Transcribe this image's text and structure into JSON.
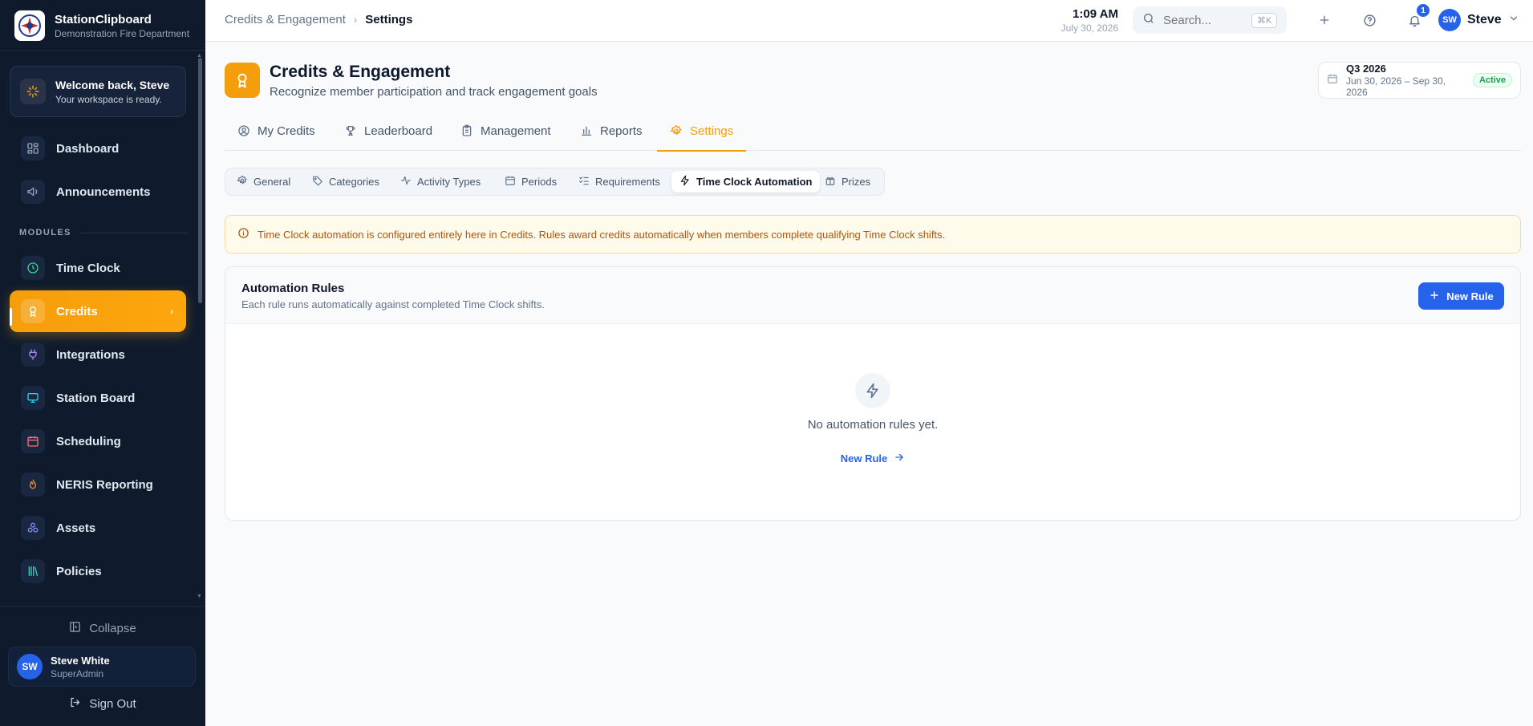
{
  "brand": {
    "name": "StationClipboard",
    "subtitle": "Demonstration Fire Department"
  },
  "welcome": {
    "title": "Welcome back, Steve",
    "subtitle": "Your workspace is ready."
  },
  "sidebar": {
    "section_label": "MODULES",
    "items": [
      {
        "label": "Dashboard",
        "icon": "grid-icon"
      },
      {
        "label": "Announcements",
        "icon": "megaphone-icon"
      },
      {
        "label": "Time Clock",
        "icon": "clock-icon"
      },
      {
        "label": "Credits",
        "icon": "award-icon",
        "active": true
      },
      {
        "label": "Integrations",
        "icon": "plug-icon"
      },
      {
        "label": "Station Board",
        "icon": "monitor-icon"
      },
      {
        "label": "Scheduling",
        "icon": "calendar-icon"
      },
      {
        "label": "NERIS Reporting",
        "icon": "flame-icon"
      },
      {
        "label": "Assets",
        "icon": "boxes-icon"
      },
      {
        "label": "Policies",
        "icon": "library-icon"
      }
    ],
    "collapse_label": "Collapse",
    "user": {
      "initials": "SW",
      "name": "Steve White",
      "role": "SuperAdmin"
    },
    "signout_label": "Sign Out"
  },
  "topbar": {
    "breadcrumb": [
      "Credits & Engagement",
      "Settings"
    ],
    "time": "1:09 AM",
    "date": "July 30, 2026",
    "search": {
      "placeholder": "Search...",
      "shortcut": "⌘K"
    },
    "notifications_count": "1",
    "user": {
      "initials": "SW",
      "name": "Steve"
    }
  },
  "page": {
    "title": "Credits & Engagement",
    "subtitle": "Recognize member participation and track engagement goals",
    "period": {
      "name": "Q3 2026",
      "range": "Jun 30, 2026 – Sep 30, 2026",
      "status": "Active"
    }
  },
  "tabs": [
    "My Credits",
    "Leaderboard",
    "Management",
    "Reports",
    "Settings"
  ],
  "subtabs": [
    "General",
    "Categories",
    "Activity Types",
    "Periods",
    "Requirements",
    "Time Clock Automation",
    "Prizes"
  ],
  "alert": "Time Clock automation is configured entirely here in Credits. Rules award credits automatically when members complete qualifying Time Clock shifts.",
  "rules_card": {
    "title": "Automation Rules",
    "subtitle": "Each rule runs automatically against completed Time Clock shifts.",
    "new_button": "New Rule",
    "empty_text": "No automation rules yet.",
    "empty_link": "New Rule"
  },
  "colors": {
    "accent": "#f59e0b",
    "primary": "#2563eb",
    "sidebar_bg": "#0f1b2d",
    "success": "#16a34a"
  }
}
